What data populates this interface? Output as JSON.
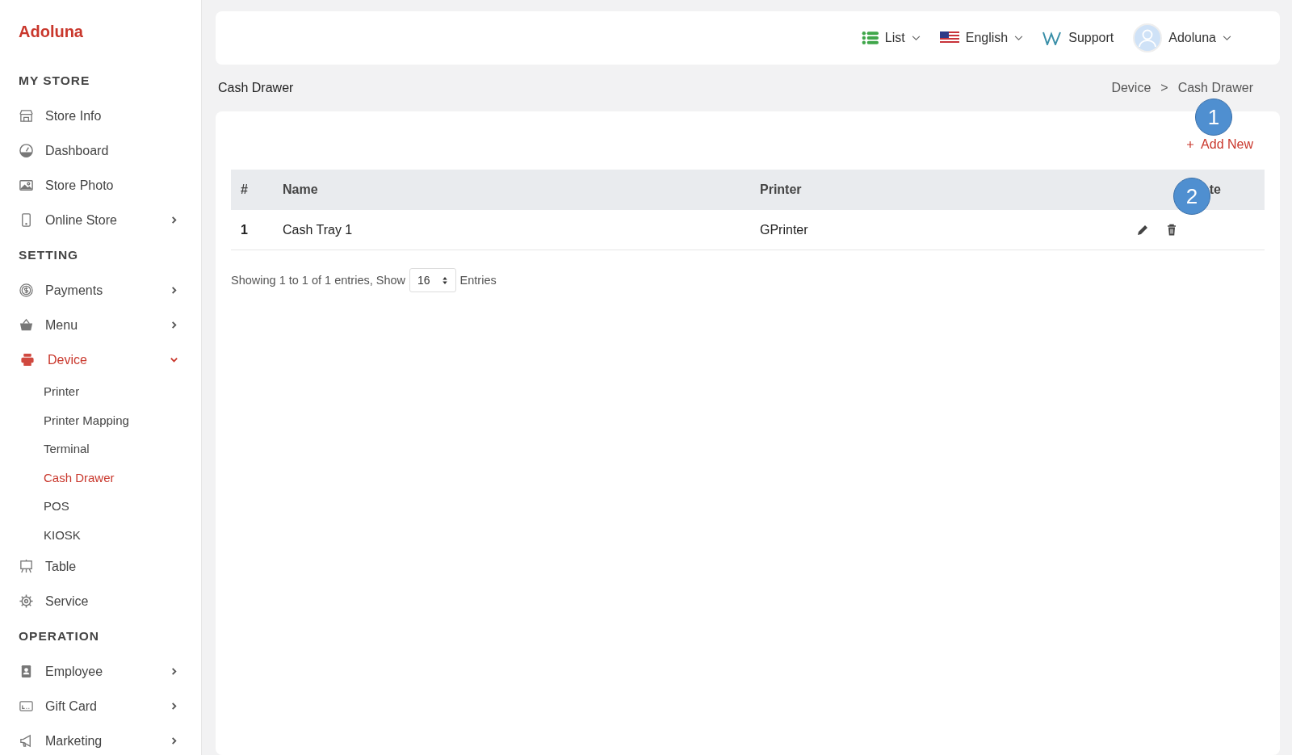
{
  "sidebar": {
    "brand": "Adoluna",
    "sections": [
      {
        "title": "MY STORE",
        "items": [
          {
            "label": "Store Info",
            "selected": false,
            "expandable": false
          },
          {
            "label": "Dashboard",
            "selected": false,
            "expandable": false
          },
          {
            "label": "Store Photo",
            "selected": false,
            "expandable": false
          },
          {
            "label": "Online Store",
            "selected": false,
            "expandable": true,
            "expanded": false
          }
        ]
      },
      {
        "title": "SETTING",
        "items": [
          {
            "label": "Payments",
            "selected": false,
            "expandable": true,
            "expanded": false
          },
          {
            "label": "Menu",
            "selected": false,
            "expandable": true,
            "expanded": false
          },
          {
            "label": "Device",
            "selected": true,
            "expandable": true,
            "expanded": true,
            "children": [
              {
                "label": "Printer",
                "selected": false
              },
              {
                "label": "Printer Mapping",
                "selected": false
              },
              {
                "label": "Terminal",
                "selected": false
              },
              {
                "label": "Cash Drawer",
                "selected": true
              },
              {
                "label": "POS",
                "selected": false
              },
              {
                "label": "KIOSK",
                "selected": false
              }
            ]
          },
          {
            "label": "Table",
            "selected": false,
            "expandable": false
          },
          {
            "label": "Service",
            "selected": false,
            "expandable": false
          }
        ]
      },
      {
        "title": "OPERATION",
        "items": [
          {
            "label": "Employee",
            "selected": false,
            "expandable": true,
            "expanded": false
          },
          {
            "label": "Gift Card",
            "selected": false,
            "expandable": true,
            "expanded": false
          },
          {
            "label": "Marketing",
            "selected": false,
            "expandable": true,
            "expanded": false
          }
        ]
      }
    ]
  },
  "topbar": {
    "view": "List",
    "language": "English",
    "support": "Support",
    "user": "Adoluna"
  },
  "page_title": "Cash Drawer",
  "breadcrumb": {
    "items": [
      "Device",
      "Cash Drawer"
    ],
    "separator": ">"
  },
  "add_button": "Add New",
  "table": {
    "columns": [
      "#",
      "Name",
      "Printer",
      "te"
    ],
    "rows": [
      {
        "index": "1",
        "name": "Cash Tray 1",
        "printer": "GPrinter"
      }
    ]
  },
  "pagination": {
    "summary": "Showing 1 to 1 of 1 entries, Show",
    "page_size": "16",
    "suffix": "Entries"
  },
  "callouts": [
    "1",
    "2"
  ]
}
